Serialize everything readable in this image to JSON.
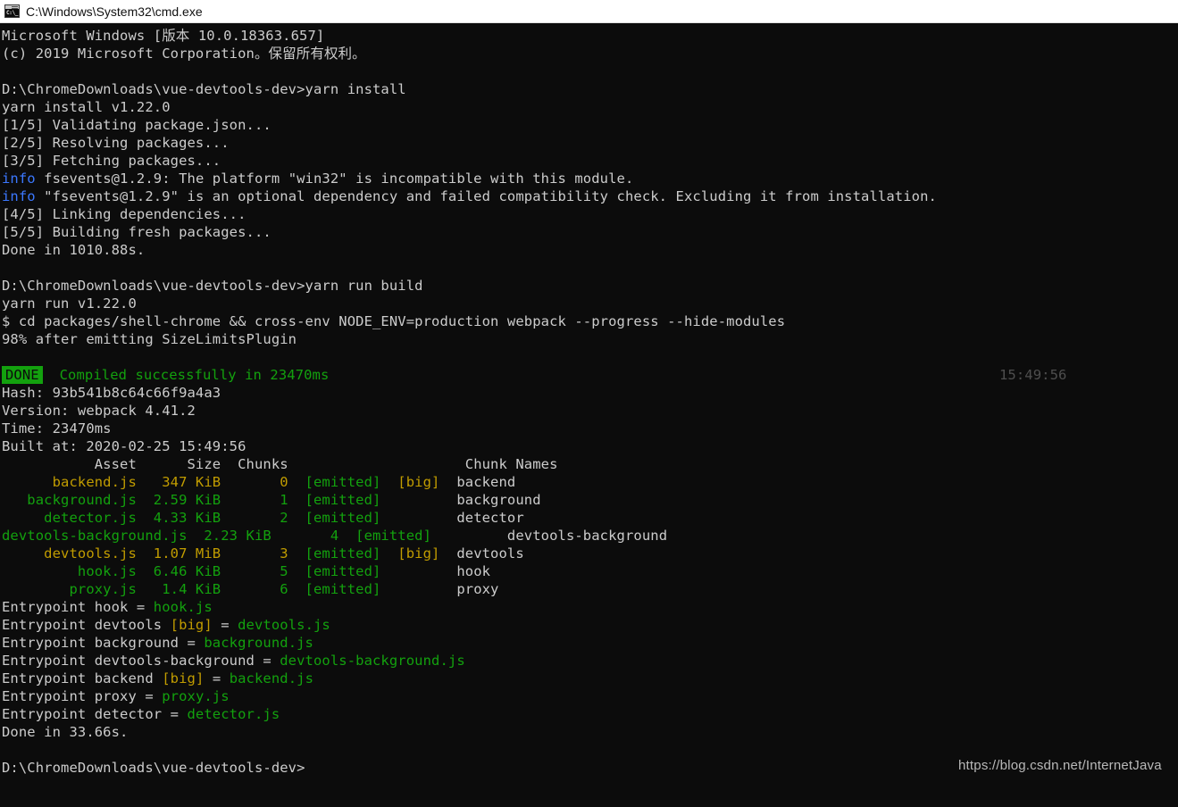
{
  "window": {
    "title": "C:\\Windows\\System32\\cmd.exe",
    "icon": "cmd-icon",
    "icon_glyph": "C:\\_",
    "background_color": "#0c0c0c",
    "foreground_color": "#cccccc"
  },
  "colors": {
    "background": "#0c0c0c",
    "default_text": "#cccccc",
    "green": "#13a10e",
    "blue": "#3b78ff",
    "yellow": "#c19c00",
    "dim": "#4e4e4e",
    "badge_bg": "#13a10e",
    "badge_fg": "#0c0c0c"
  },
  "console": {
    "lines": [
      {
        "id": "banner-version",
        "segments": [
          {
            "text": "Microsoft Windows [版本 10.0.18363.657]",
            "color": "default"
          }
        ]
      },
      {
        "id": "banner-copyright",
        "segments": [
          {
            "text": "(c) 2019 Microsoft Corporation。保留所有权利。",
            "color": "default"
          }
        ]
      },
      {
        "id": "blank-1",
        "segments": [
          {
            "text": "",
            "color": "default"
          }
        ]
      },
      {
        "id": "prompt-yarn-install",
        "segments": [
          {
            "text": "D:\\ChromeDownloads\\vue-devtools-dev>yarn install",
            "color": "default"
          }
        ]
      },
      {
        "id": "yarn-install-version",
        "segments": [
          {
            "text": "yarn install v1.22.0",
            "color": "default"
          }
        ]
      },
      {
        "id": "step-1-5",
        "segments": [
          {
            "text": "[1/5] Validating package.json...",
            "color": "default"
          }
        ]
      },
      {
        "id": "step-2-5",
        "segments": [
          {
            "text": "[2/5] Resolving packages...",
            "color": "default"
          }
        ]
      },
      {
        "id": "step-3-5",
        "segments": [
          {
            "text": "[3/5] Fetching packages...",
            "color": "default"
          }
        ]
      },
      {
        "id": "info-fsevents-platform",
        "segments": [
          {
            "text": "info",
            "color": "blue"
          },
          {
            "text": " fsevents@1.2.9: The platform \"win32\" is incompatible with this module.",
            "color": "default"
          }
        ]
      },
      {
        "id": "info-fsevents-optional",
        "segments": [
          {
            "text": "info",
            "color": "blue"
          },
          {
            "text": " \"fsevents@1.2.9\" is an optional dependency and failed compatibility check. Excluding it from installation.",
            "color": "default"
          }
        ]
      },
      {
        "id": "step-4-5",
        "segments": [
          {
            "text": "[4/5] Linking dependencies...",
            "color": "default"
          }
        ]
      },
      {
        "id": "step-5-5",
        "segments": [
          {
            "text": "[5/5] Building fresh packages...",
            "color": "default"
          }
        ]
      },
      {
        "id": "install-done",
        "segments": [
          {
            "text": "Done in 1010.88s.",
            "color": "default"
          }
        ]
      },
      {
        "id": "blank-2",
        "segments": [
          {
            "text": "",
            "color": "default"
          }
        ]
      },
      {
        "id": "prompt-yarn-run-build",
        "segments": [
          {
            "text": "D:\\ChromeDownloads\\vue-devtools-dev>yarn run build",
            "color": "default"
          }
        ]
      },
      {
        "id": "yarn-run-version",
        "segments": [
          {
            "text": "yarn run v1.22.0",
            "color": "default"
          }
        ]
      },
      {
        "id": "build-command",
        "segments": [
          {
            "text": "$ cd packages/shell-chrome && cross-env NODE_ENV=production webpack --progress --hide-modules",
            "color": "default"
          }
        ]
      },
      {
        "id": "progress-98",
        "segments": [
          {
            "text": "98% after emitting SizeLimitsPlugin",
            "color": "default"
          }
        ]
      },
      {
        "id": "blank-3",
        "segments": [
          {
            "text": "",
            "color": "default"
          }
        ]
      },
      {
        "id": "compiled-success",
        "badge": "DONE",
        "segments": [
          {
            "text": "  Compiled successfully in 23470ms",
            "color": "green"
          }
        ],
        "right_text": "15:49:56",
        "right_color": "dim"
      },
      {
        "id": "hash",
        "segments": [
          {
            "text": "Hash: 93b541b8c64c66f9a4a3",
            "color": "default"
          }
        ]
      },
      {
        "id": "version",
        "segments": [
          {
            "text": "Version: webpack 4.41.2",
            "color": "default"
          }
        ]
      },
      {
        "id": "time",
        "segments": [
          {
            "text": "Time: 23470ms",
            "color": "default"
          }
        ]
      },
      {
        "id": "built-at",
        "segments": [
          {
            "text": "Built at: 2020-02-25 15:49:56",
            "color": "default"
          }
        ]
      },
      {
        "id": "table-header",
        "segments": [
          {
            "text": "           Asset      Size  Chunks             ",
            "color": "default"
          },
          {
            "text": "        ",
            "color": "default"
          },
          {
            "text": "Chunk Names",
            "color": "default"
          }
        ]
      },
      {
        "id": "asset-backend",
        "segments": [
          {
            "text": "      backend.js   347 KiB       0  ",
            "color": "yellow"
          },
          {
            "text": "[emitted]  ",
            "color": "green"
          },
          {
            "text": "[big]  ",
            "color": "yellow"
          },
          {
            "text": "backend",
            "color": "default"
          }
        ]
      },
      {
        "id": "asset-background",
        "segments": [
          {
            "text": "   background.js  2.59 KiB       1  ",
            "color": "green"
          },
          {
            "text": "[emitted]         ",
            "color": "green"
          },
          {
            "text": "background",
            "color": "default"
          }
        ]
      },
      {
        "id": "asset-detector",
        "segments": [
          {
            "text": "     detector.js  4.33 KiB       2  ",
            "color": "green"
          },
          {
            "text": "[emitted]         ",
            "color": "green"
          },
          {
            "text": "detector",
            "color": "default"
          }
        ]
      },
      {
        "id": "asset-devtools-background",
        "segments": [
          {
            "text": "devtools-background.js  2.23 KiB       4  ",
            "color": "green"
          },
          {
            "text": "[emitted]         ",
            "color": "green"
          },
          {
            "text": "devtools-background",
            "color": "default"
          }
        ]
      },
      {
        "id": "asset-devtools",
        "segments": [
          {
            "text": "     devtools.js  1.07 MiB       3  ",
            "color": "yellow"
          },
          {
            "text": "[emitted]  ",
            "color": "green"
          },
          {
            "text": "[big]  ",
            "color": "yellow"
          },
          {
            "text": "devtools",
            "color": "default"
          }
        ]
      },
      {
        "id": "asset-hook",
        "segments": [
          {
            "text": "         hook.js  6.46 KiB       5  ",
            "color": "green"
          },
          {
            "text": "[emitted]         ",
            "color": "green"
          },
          {
            "text": "hook",
            "color": "default"
          }
        ]
      },
      {
        "id": "asset-proxy",
        "segments": [
          {
            "text": "        proxy.js   1.4 KiB       6  ",
            "color": "green"
          },
          {
            "text": "[emitted]         ",
            "color": "green"
          },
          {
            "text": "proxy",
            "color": "default"
          }
        ]
      },
      {
        "id": "entrypoint-hook",
        "segments": [
          {
            "text": "Entrypoint hook = ",
            "color": "default"
          },
          {
            "text": "hook.js",
            "color": "green"
          }
        ]
      },
      {
        "id": "entrypoint-devtools",
        "segments": [
          {
            "text": "Entrypoint devtools ",
            "color": "default"
          },
          {
            "text": "[big]",
            "color": "yellow"
          },
          {
            "text": " = ",
            "color": "default"
          },
          {
            "text": "devtools.js",
            "color": "green"
          }
        ]
      },
      {
        "id": "entrypoint-background",
        "segments": [
          {
            "text": "Entrypoint background = ",
            "color": "default"
          },
          {
            "text": "background.js",
            "color": "green"
          }
        ]
      },
      {
        "id": "entrypoint-devtools-background",
        "segments": [
          {
            "text": "Entrypoint devtools-background = ",
            "color": "default"
          },
          {
            "text": "devtools-background.js",
            "color": "green"
          }
        ]
      },
      {
        "id": "entrypoint-backend",
        "segments": [
          {
            "text": "Entrypoint backend ",
            "color": "default"
          },
          {
            "text": "[big]",
            "color": "yellow"
          },
          {
            "text": " = ",
            "color": "default"
          },
          {
            "text": "backend.js",
            "color": "green"
          }
        ]
      },
      {
        "id": "entrypoint-proxy",
        "segments": [
          {
            "text": "Entrypoint proxy = ",
            "color": "default"
          },
          {
            "text": "proxy.js",
            "color": "green"
          }
        ]
      },
      {
        "id": "entrypoint-detector",
        "segments": [
          {
            "text": "Entrypoint detector = ",
            "color": "default"
          },
          {
            "text": "detector.js",
            "color": "green"
          }
        ]
      },
      {
        "id": "build-done",
        "segments": [
          {
            "text": "Done in 33.66s.",
            "color": "default"
          }
        ]
      },
      {
        "id": "blank-4",
        "segments": [
          {
            "text": "",
            "color": "default"
          }
        ]
      },
      {
        "id": "prompt-final",
        "segments": [
          {
            "text": "D:\\ChromeDownloads\\vue-devtools-dev>",
            "color": "default"
          }
        ]
      }
    ],
    "build_table": {
      "headers": [
        "Asset",
        "Size",
        "Chunks",
        "",
        "Chunk Names"
      ],
      "rows": [
        {
          "asset": "backend.js",
          "size": "347 KiB",
          "chunks": "0",
          "emitted": "[emitted]",
          "big": "[big]",
          "chunk_name": "backend"
        },
        {
          "asset": "background.js",
          "size": "2.59 KiB",
          "chunks": "1",
          "emitted": "[emitted]",
          "big": "",
          "chunk_name": "background"
        },
        {
          "asset": "detector.js",
          "size": "4.33 KiB",
          "chunks": "2",
          "emitted": "[emitted]",
          "big": "",
          "chunk_name": "detector"
        },
        {
          "asset": "devtools-background.js",
          "size": "2.23 KiB",
          "chunks": "4",
          "emitted": "[emitted]",
          "big": "",
          "chunk_name": "devtools-background"
        },
        {
          "asset": "devtools.js",
          "size": "1.07 MiB",
          "chunks": "3",
          "emitted": "[emitted]",
          "big": "[big]",
          "chunk_name": "devtools"
        },
        {
          "asset": "hook.js",
          "size": "6.46 KiB",
          "chunks": "5",
          "emitted": "[emitted]",
          "big": "",
          "chunk_name": "hook"
        },
        {
          "asset": "proxy.js",
          "size": "1.4 KiB",
          "chunks": "6",
          "emitted": "[emitted]",
          "big": "",
          "chunk_name": "proxy"
        }
      ]
    },
    "build_summary": {
      "hash": "93b541b8c64c66f9a4a3",
      "webpack_version": "4.41.2",
      "time_ms": "23470ms",
      "built_at": "2020-02-25 15:49:56",
      "status_badge": "DONE",
      "status_text": "Compiled successfully in 23470ms",
      "timestamp": "15:49:56",
      "install_duration": "1010.88s",
      "build_duration": "33.66s",
      "yarn_version": "v1.22.0",
      "progress": "98%"
    }
  },
  "watermark": {
    "text": "https://blog.csdn.net/InternetJava"
  }
}
